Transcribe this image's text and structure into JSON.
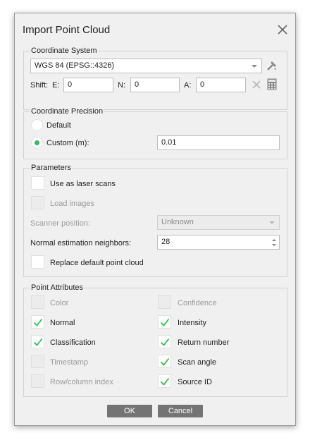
{
  "dialog": {
    "title": "Import Point Cloud"
  },
  "coordinate_system": {
    "group_title": "Coordinate System",
    "selected": "WGS 84 (EPSG::4326)",
    "shift_label": "Shift:",
    "e_label": "E:",
    "e_value": "0",
    "n_label": "N:",
    "n_value": "0",
    "a_label": "A:",
    "a_value": "0"
  },
  "precision": {
    "group_title": "Coordinate Precision",
    "default_label": "Default",
    "custom_label": "Custom (m):",
    "custom_value": "0.01",
    "selected": "custom"
  },
  "parameters": {
    "group_title": "Parameters",
    "laser_scans_label": "Use as laser scans",
    "load_images_label": "Load images",
    "scanner_position_label": "Scanner position:",
    "scanner_position_value": "Unknown",
    "normal_neighbors_label": "Normal estimation neighbors:",
    "normal_neighbors_value": "28",
    "replace_default_label": "Replace default point cloud"
  },
  "attributes": {
    "group_title": "Point Attributes",
    "items": [
      {
        "label": "Color",
        "checked": false,
        "enabled": false
      },
      {
        "label": "Confidence",
        "checked": false,
        "enabled": false
      },
      {
        "label": "Normal",
        "checked": true,
        "enabled": true
      },
      {
        "label": "Intensity",
        "checked": true,
        "enabled": true
      },
      {
        "label": "Classification",
        "checked": true,
        "enabled": true
      },
      {
        "label": "Return number",
        "checked": true,
        "enabled": true
      },
      {
        "label": "Timestamp",
        "checked": false,
        "enabled": false
      },
      {
        "label": "Scan angle",
        "checked": true,
        "enabled": true
      },
      {
        "label": "Row/column index",
        "checked": false,
        "enabled": false
      },
      {
        "label": "Source ID",
        "checked": true,
        "enabled": true
      }
    ]
  },
  "buttons": {
    "ok": "OK",
    "cancel": "Cancel"
  },
  "colors": {
    "check": "#2ec24e",
    "button": "#747474"
  }
}
